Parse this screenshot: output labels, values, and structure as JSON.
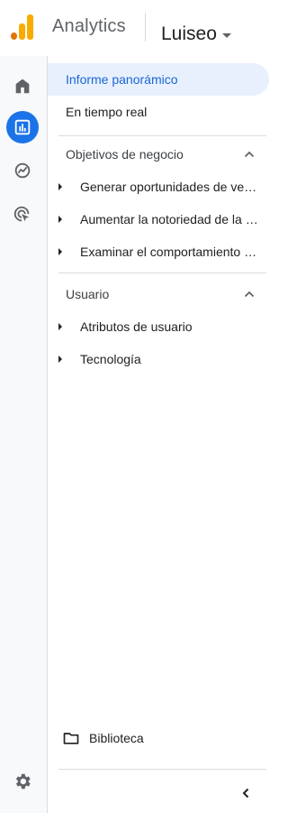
{
  "header": {
    "app_name": "Analytics",
    "account_name": "Luiseo",
    "logo_colors": [
      "#f9ab00",
      "#e37400",
      "#f9ab00"
    ]
  },
  "rail": {
    "items": [
      {
        "icon": "home-icon",
        "active": false
      },
      {
        "icon": "reports-icon",
        "active": true
      },
      {
        "icon": "explore-icon",
        "active": false
      },
      {
        "icon": "advertising-icon",
        "active": false
      }
    ],
    "settings_icon": "gear-icon"
  },
  "nav": {
    "overview": "Informe panorámico",
    "realtime": "En tiempo real",
    "sections": [
      {
        "title": "Objetivos de negocio",
        "items": [
          "Generar oportunidades de venta",
          "Aumentar la notoriedad de la marca",
          "Examinar el comportamiento de los usuarios"
        ]
      },
      {
        "title": "Usuario",
        "items": [
          "Atributos de usuario",
          "Tecnología"
        ]
      }
    ],
    "library": "Biblioteca"
  },
  "colors": {
    "accent": "#1a73e8",
    "selected_bg": "#e8f0fe",
    "selected_text": "#1967d2"
  }
}
